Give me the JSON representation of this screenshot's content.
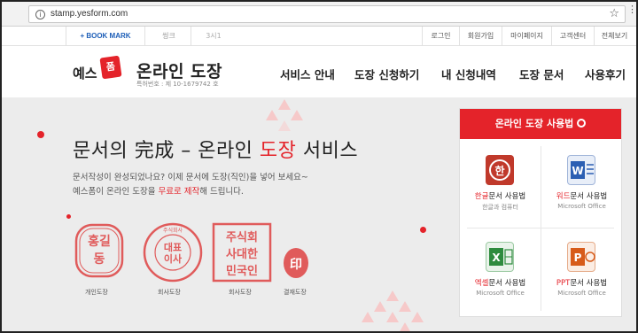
{
  "browser": {
    "url": "stamp.yesform.com",
    "info_icon": "info-icon",
    "star_icon": "star-icon"
  },
  "utility": {
    "bookmark": "+ BOOK MARK",
    "logo_sk": "씽크",
    "logo_3": "3시1",
    "menu": [
      "로그인",
      "회원가입",
      "마이페이지",
      "고객센터",
      "전체보기"
    ]
  },
  "header": {
    "logo_text": "예스",
    "logo_mark": "폼",
    "title": "온라인 도장",
    "patent": "특허번호 : 제 10-1679742 호",
    "nav": [
      "서비스 안내",
      "도장 신청하기",
      "내 신청내역",
      "도장 문서",
      "사용후기"
    ]
  },
  "hero": {
    "headline_a": "문서의 完成 – 온라인 ",
    "headline_red": "도장",
    "headline_b": " 서비스",
    "desc_line1": "문서작성이 완성되었나요? 이제 문서에 도장(직인)을 넣어 보세요~",
    "desc_line2a": "예스폼이 온라인 도장을 ",
    "desc_line2_red": "무료로 제작",
    "desc_line2b": "해 드립니다.",
    "stamps": [
      {
        "caption": "개인도장",
        "text": "홍길동"
      },
      {
        "caption": "회사도장",
        "text": "대표이사"
      },
      {
        "caption": "회사도장",
        "text": "주식회사대한민국인"
      },
      {
        "caption": "결재도장",
        "text": "印"
      }
    ]
  },
  "panel": {
    "title": "온라인 도장 사용법",
    "items": [
      {
        "red": "한글",
        "rest": "문서 사용법",
        "sub": "한글과 컴퓨터",
        "icon": "hwp-icon",
        "color": "#c0392b"
      },
      {
        "red": "워드",
        "rest": "문서 사용법",
        "sub": "Microsoft Office",
        "icon": "word-icon",
        "color": "#2b5fb3"
      },
      {
        "red": "엑셀",
        "rest": "문서 사용법",
        "sub": "Microsoft Office",
        "icon": "excel-icon",
        "color": "#2e8b3e"
      },
      {
        "red": "PPT",
        "rest": "문서 사용법",
        "sub": "Microsoft Office",
        "icon": "ppt-icon",
        "color": "#d75b1a"
      }
    ]
  },
  "colors": {
    "accent": "#e4232a",
    "hero_bg": "#ececec",
    "triangle": "#f6c9c9"
  }
}
